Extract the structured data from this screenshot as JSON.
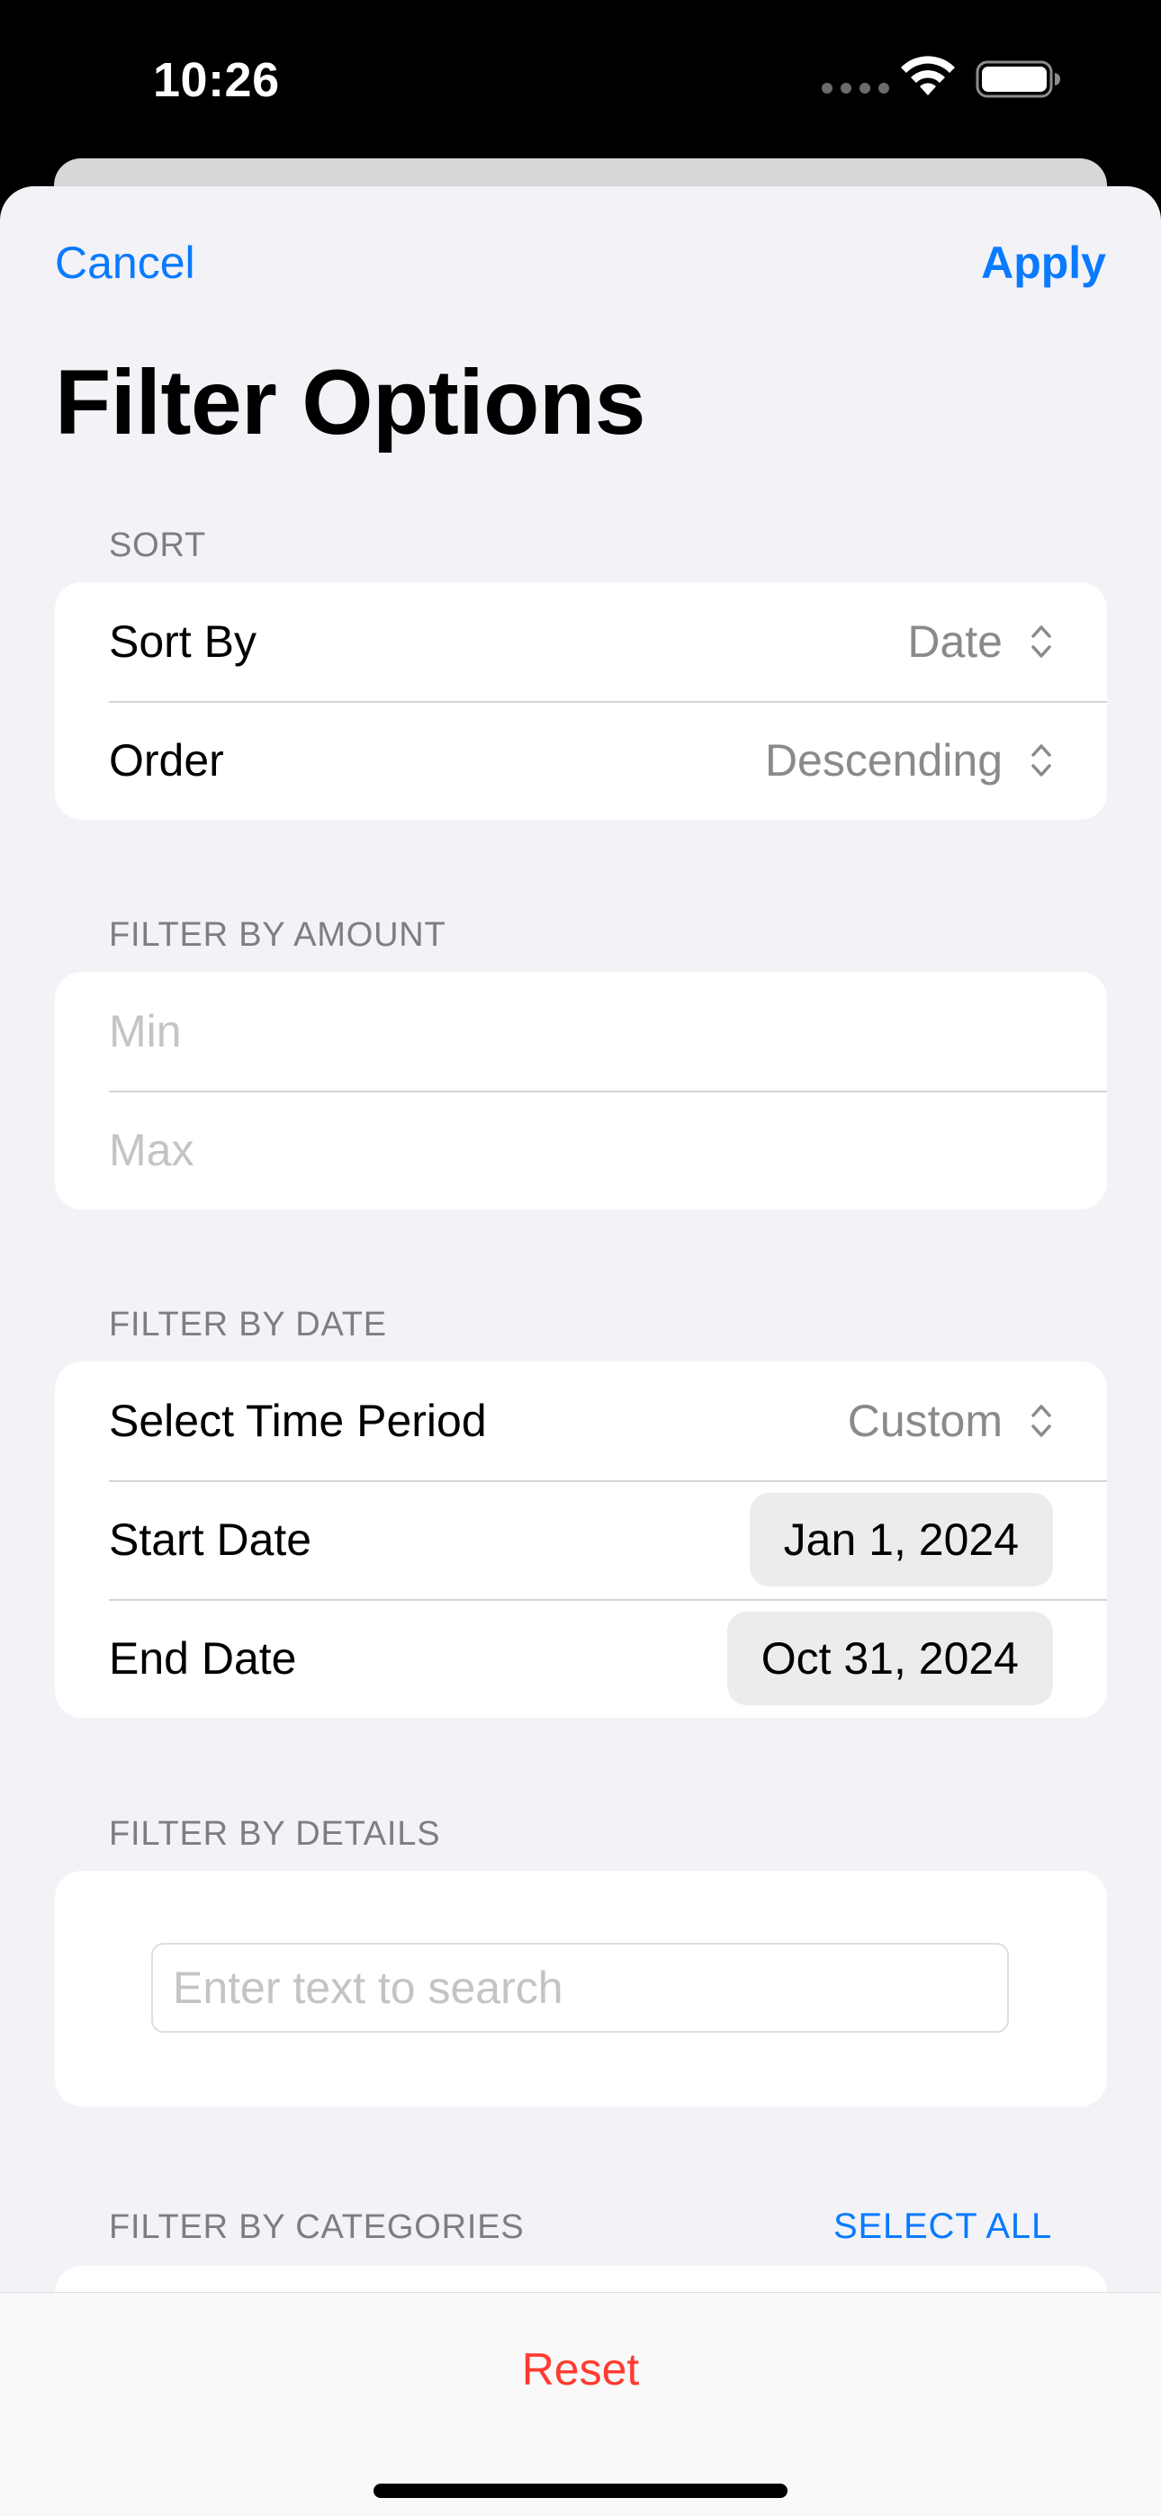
{
  "status_bar": {
    "time": "10:26"
  },
  "nav": {
    "cancel_label": "Cancel",
    "apply_label": "Apply",
    "title": "Filter Options"
  },
  "sort": {
    "header": "SORT",
    "rows": [
      {
        "label": "Sort By",
        "value": "Date"
      },
      {
        "label": "Order",
        "value": "Descending"
      }
    ]
  },
  "amount": {
    "header": "FILTER BY AMOUNT",
    "min_placeholder": "Min",
    "max_placeholder": "Max"
  },
  "date": {
    "header": "FILTER BY DATE",
    "time_period_label": "Select Time Period",
    "time_period_value": "Custom",
    "start_label": "Start Date",
    "start_value": "Jan 1, 2024",
    "end_label": "End Date",
    "end_value": "Oct 31, 2024"
  },
  "details": {
    "header": "FILTER BY DETAILS",
    "search_placeholder": "Enter text to search"
  },
  "categories": {
    "header": "FILTER BY CATEGORIES",
    "select_all_label": "SELECT ALL"
  },
  "bottom": {
    "reset_label": "Reset"
  },
  "colors": {
    "accent": "#0a7aff",
    "destructive": "#ff3b30",
    "grouped_background": "#f2f2f7"
  },
  "icons": [
    "wifi-icon",
    "battery-icon",
    "chevron-updown-icon"
  ]
}
